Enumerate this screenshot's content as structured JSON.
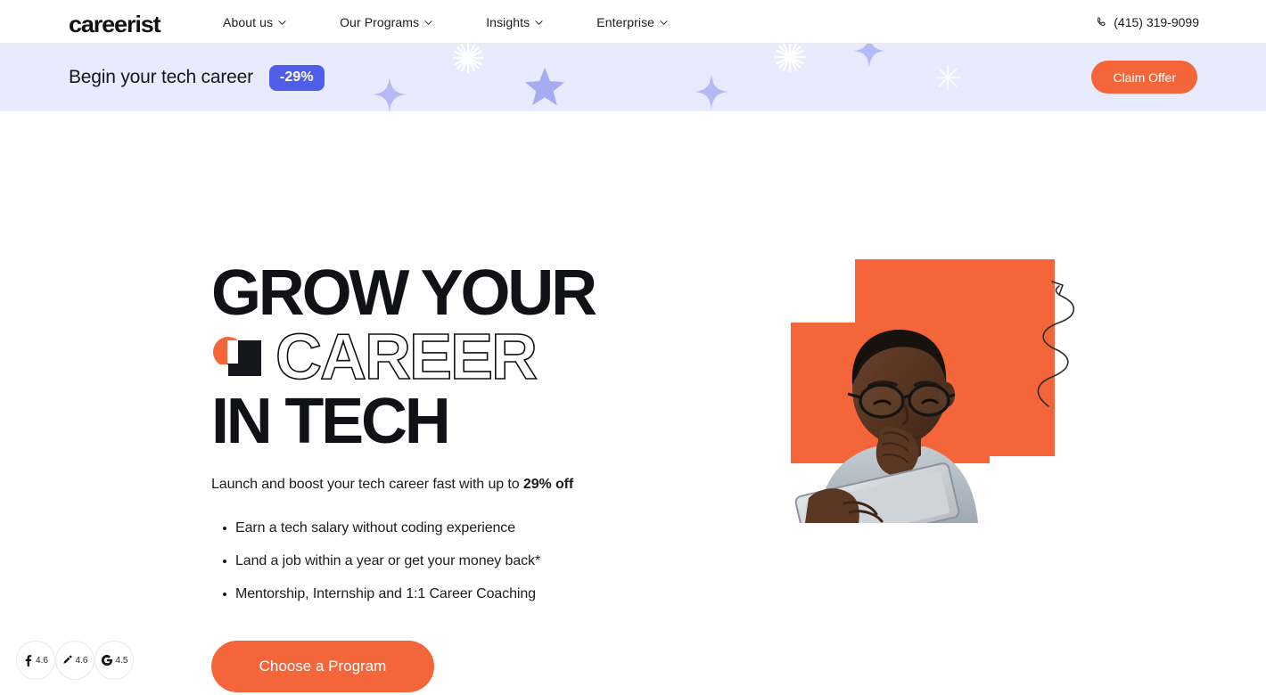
{
  "brand": {
    "logo_text": "careerist",
    "accent_orange": "#f4663a",
    "banner_bg": "#e8eafd",
    "badge_blue": "#4f5ee8"
  },
  "nav": {
    "items": [
      {
        "label": "About us",
        "icon": "chevron-down-icon"
      },
      {
        "label": "Our Programs",
        "icon": "chevron-down-icon"
      },
      {
        "label": "Insights",
        "icon": "chevron-down-icon"
      },
      {
        "label": "Enterprise",
        "icon": "chevron-down-icon"
      }
    ],
    "phone": {
      "label": "(415) 319-9099",
      "icon": "phone-icon"
    }
  },
  "banner": {
    "title": "Begin your tech career",
    "discount_badge": "-29%",
    "cta_label": "Claim Offer"
  },
  "hero": {
    "headline_line1": "GROW YOUR",
    "headline_line2": "CAREER",
    "headline_line3": "IN TECH",
    "mark_icon": "careerist-logo-mark-icon",
    "subtitle_prefix": "Launch and boost your tech career fast with up to ",
    "subtitle_bold": "29% off",
    "bullets": [
      "Earn a tech salary without coding experience",
      "Land a job within a year or get your money back*",
      "Mentorship, Internship and 1:1 Career Coaching"
    ],
    "cta_label": "Choose a Program",
    "image_alt": "man-with-tablet-photo",
    "arrow_icon": "squiggly-arrow-up-icon"
  },
  "ratings": [
    {
      "icon": "facebook-icon",
      "score": "4.6"
    },
    {
      "icon": "coursereport-icon",
      "score": "4.6"
    },
    {
      "icon": "google-icon",
      "score": "4.5"
    }
  ]
}
